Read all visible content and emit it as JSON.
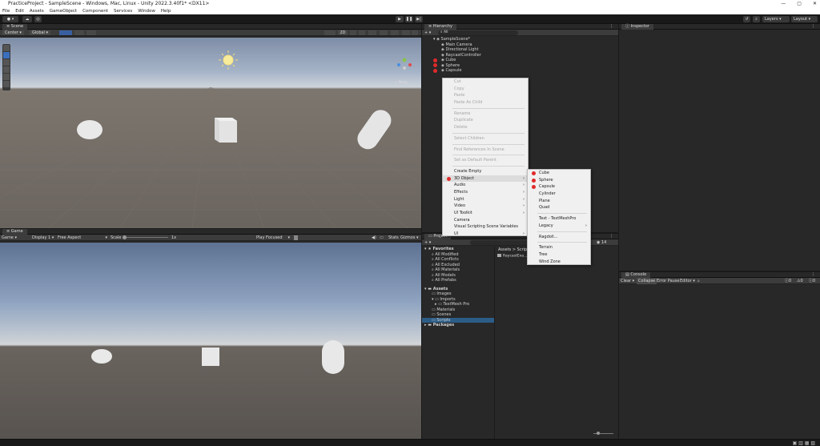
{
  "window": {
    "title": "PracticeProject - SampleScene - Windows, Mac, Linux - Unity 2022.3.40f1* <DX11>"
  },
  "menu": [
    "File",
    "Edit",
    "Assets",
    "GameObject",
    "Component",
    "Services",
    "Window",
    "Help"
  ],
  "toolbar": {
    "layers": "Layers",
    "layout": "Layout"
  },
  "scene": {
    "tab": "Scene",
    "pivot": "Center",
    "space": "Global",
    "persp": "< Persp",
    "mode": "2D"
  },
  "game": {
    "tab": "Game",
    "mode": "Game",
    "display": "Display 1",
    "aspect": "Free Aspect",
    "scale_label": "Scale",
    "scale_value": "1x",
    "play_focused": "Play Focused",
    "stats": "Stats",
    "gizmos": "Gizmos"
  },
  "hierarchy": {
    "tab": "Hierarchy",
    "search": "All",
    "scene": "SampleScene*",
    "items": [
      "Main Camera",
      "Directional Light",
      "RaycastController",
      "Cube",
      "Sphere",
      "Capsule"
    ]
  },
  "context_menu": {
    "group1": [
      "Cut",
      "Copy",
      "Paste",
      "Paste As Child"
    ],
    "group2": [
      "Rename",
      "Duplicate",
      "Delete"
    ],
    "group3": [
      "Select Children"
    ],
    "group4": [
      "Find References In Scene"
    ],
    "group5": [
      "Set as Default Parent"
    ],
    "group6": [
      "Create Empty",
      "3D Object",
      "Audio",
      "Effects",
      "Light",
      "Video",
      "UI Toolkit",
      "Camera",
      "Visual Scripting Scene Variables",
      "UI"
    ],
    "submenu_arrow": "›"
  },
  "submenu": {
    "group1": [
      "Cube",
      "Sphere",
      "Capsule",
      "Cylinder",
      "Plane",
      "Quad"
    ],
    "group2": [
      "Text - TextMeshPro",
      "Legacy"
    ],
    "group3": [
      "Ragdoll..."
    ],
    "group4": [
      "Terrain",
      "Tree",
      "Wind Zone"
    ]
  },
  "project": {
    "tab": "Project",
    "count": "14",
    "favorites": "Favorites",
    "fav_items": [
      "All Modified",
      "All Conflicts",
      "All Excluded",
      "All Materials",
      "All Models",
      "All Prefabs"
    ],
    "assets": "Assets",
    "asset_items": [
      "Images",
      "Imports",
      "TextMesh Pro",
      "Materials",
      "Scenes",
      "Scripts"
    ],
    "packages": "Packages",
    "breadcrumb_root": "Assets",
    "breadcrumb_sep": ">",
    "breadcrumb_leaf": "Scripts",
    "file": "RaycastExa..."
  },
  "inspector": {
    "tab": "Inspector"
  },
  "console": {
    "tab": "Console",
    "clear": "Clear",
    "collapse": "Collapse",
    "error_pause": "Error Pause",
    "editor": "Editor",
    "counts": [
      "0",
      "0",
      "0"
    ]
  },
  "colors": {
    "accent": "#e02a2a",
    "panel": "#282828",
    "menu_bg": "#f0f0f0"
  }
}
